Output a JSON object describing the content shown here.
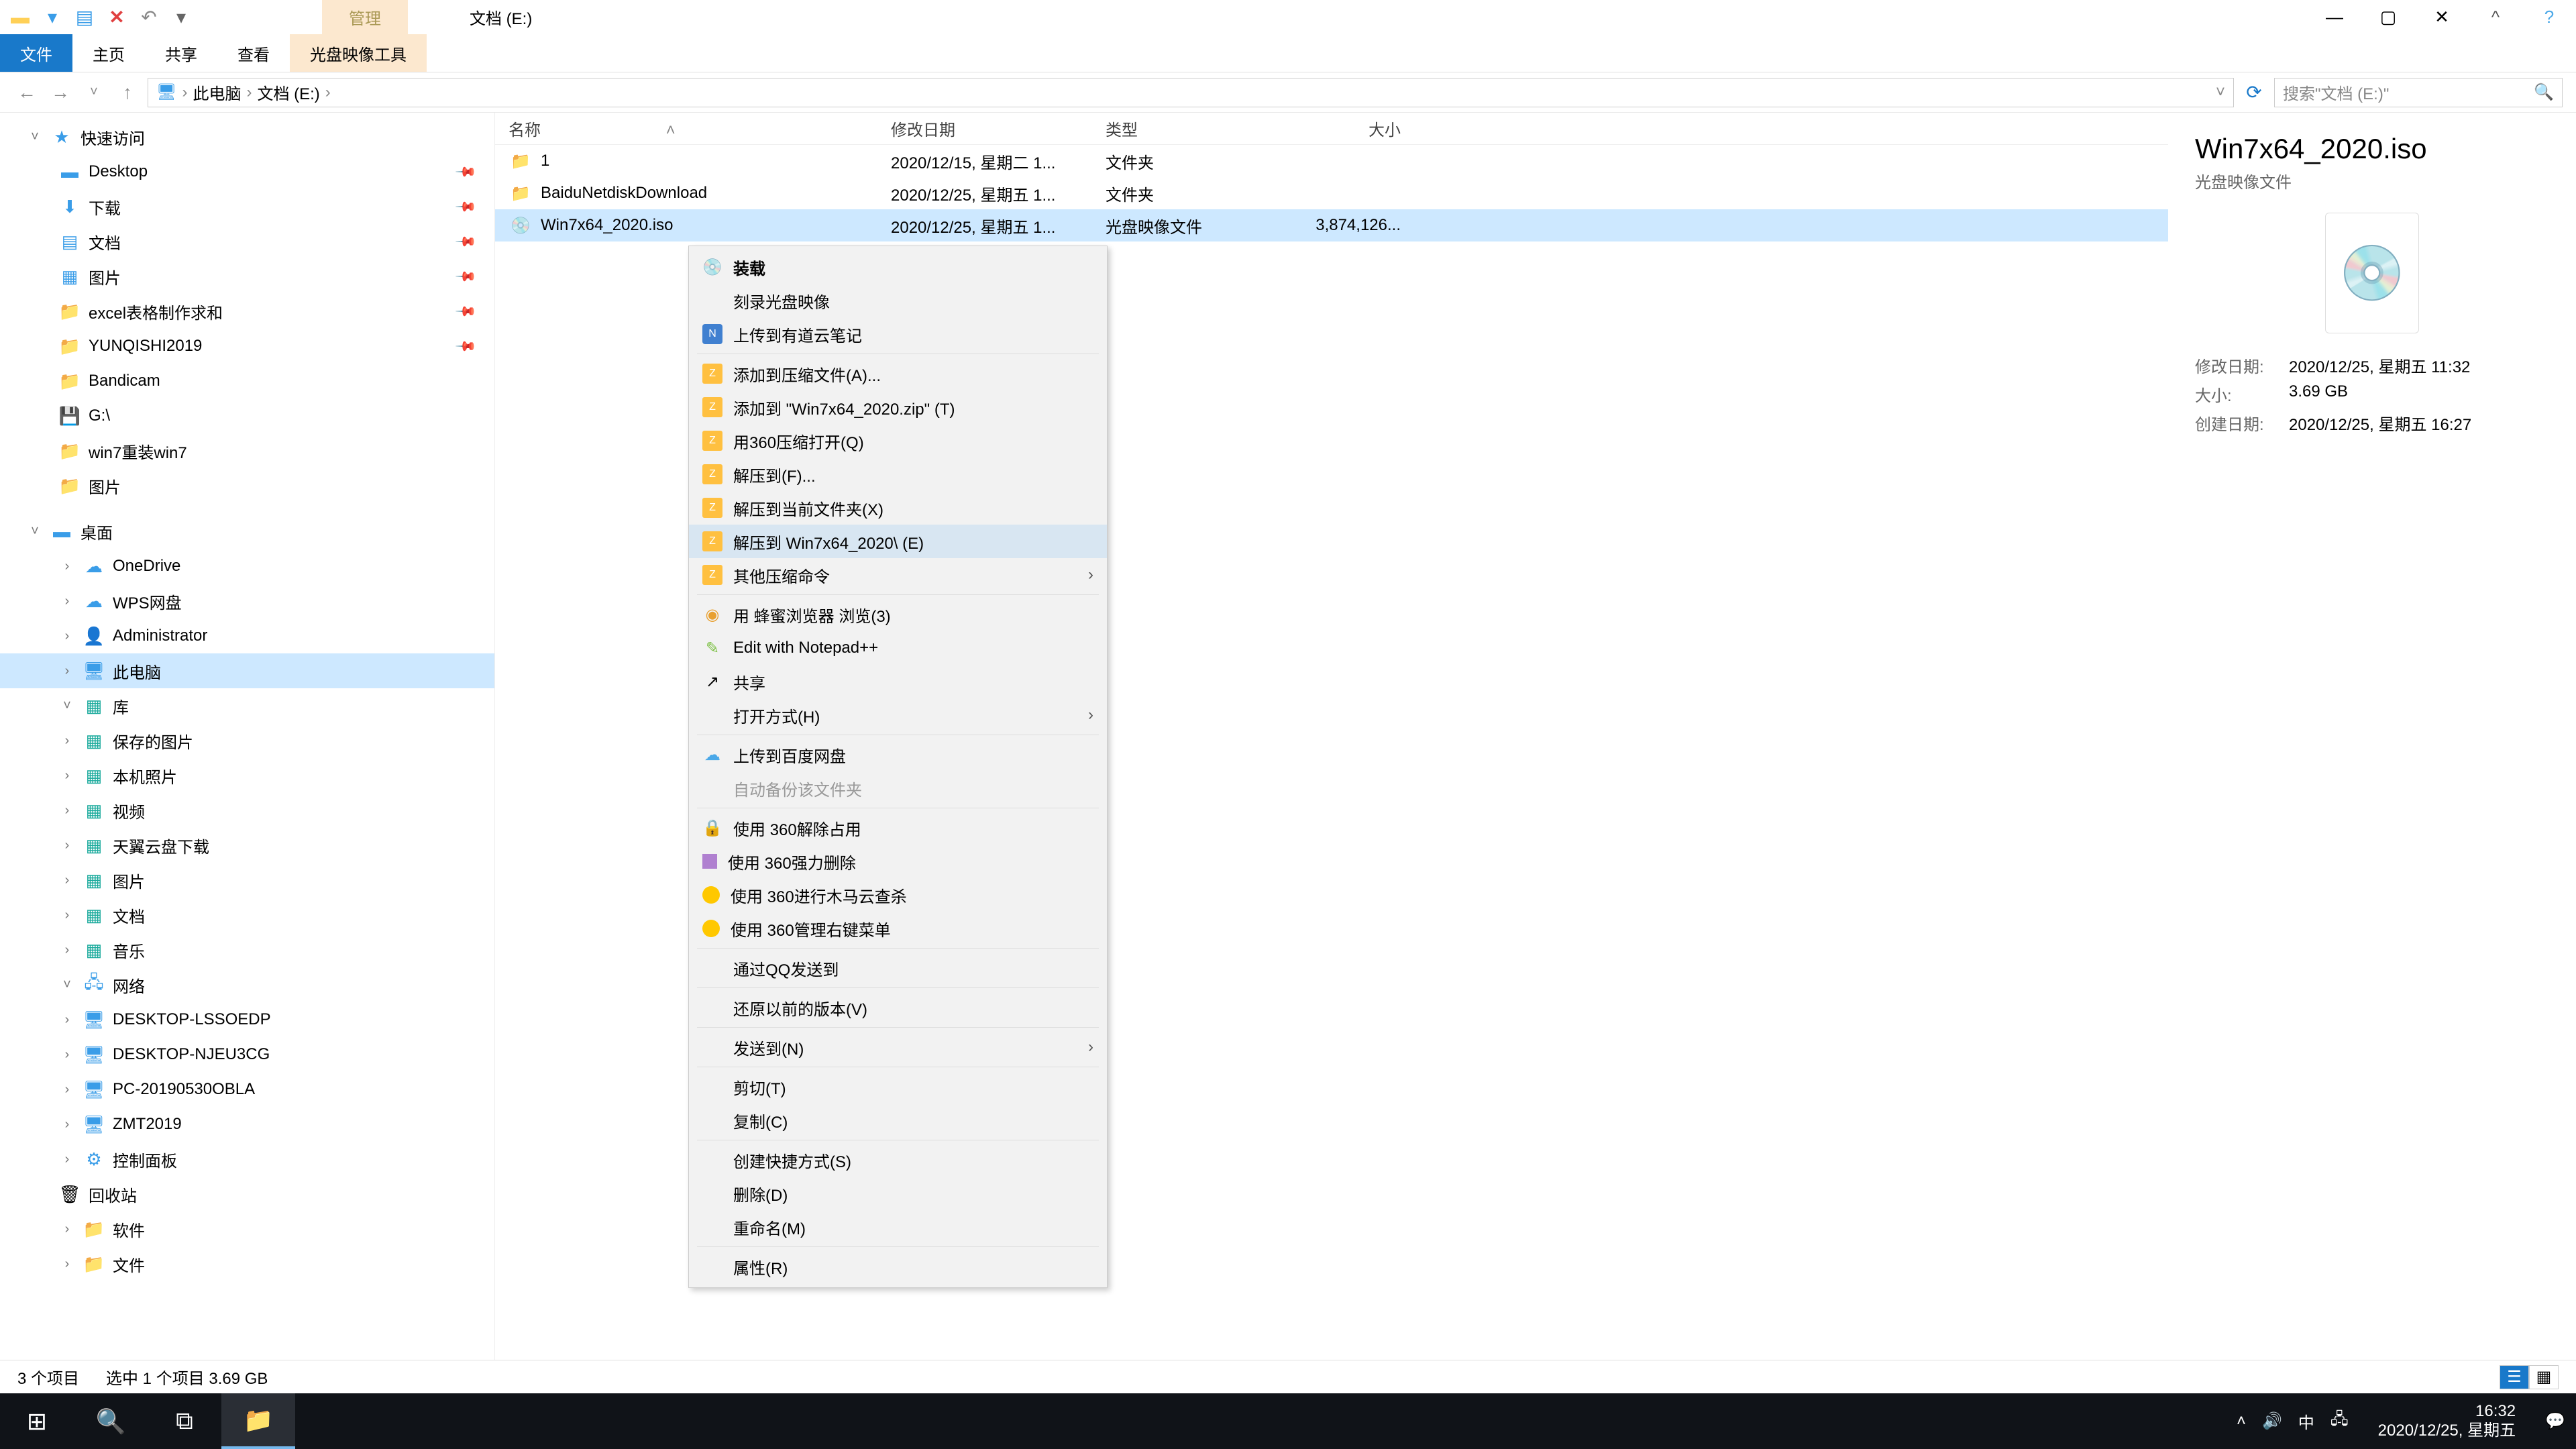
{
  "window": {
    "manage_tab": "管理",
    "title": "文档 (E:)"
  },
  "ribbon": {
    "file": "文件",
    "home": "主页",
    "share": "共享",
    "view": "查看",
    "disc_tools": "光盘映像工具"
  },
  "address": {
    "computer": "此电脑",
    "drive": "文档 (E:)",
    "search_placeholder": "搜索\"文档 (E:)\""
  },
  "tree": {
    "quick_access": "快速访问",
    "desktop": "Desktop",
    "downloads": "下载",
    "documents": "文档",
    "pictures": "图片",
    "excel": "excel表格制作求和",
    "yunqishi": "YUNQISHI2019",
    "bandicam": "Bandicam",
    "gdrive": "G:\\",
    "win7reinstall": "win7重装win7",
    "pictures2": "图片",
    "desktop2": "桌面",
    "onedrive": "OneDrive",
    "wps": "WPS网盘",
    "admin": "Administrator",
    "this_pc": "此电脑",
    "libraries": "库",
    "saved_pics": "保存的图片",
    "camera_roll": "本机照片",
    "videos": "视频",
    "tianyi": "天翼云盘下载",
    "lib_pics": "图片",
    "lib_docs": "文档",
    "lib_music": "音乐",
    "network": "网络",
    "pc1": "DESKTOP-LSSOEDP",
    "pc2": "DESKTOP-NJEU3CG",
    "pc3": "PC-20190530OBLA",
    "pc4": "ZMT2019",
    "control_panel": "控制面板",
    "recycle": "回收站",
    "software": "软件",
    "files": "文件"
  },
  "columns": {
    "name": "名称",
    "date": "修改日期",
    "type": "类型",
    "size": "大小"
  },
  "files": [
    {
      "name": "1",
      "date": "2020/12/15, 星期二 1...",
      "type": "文件夹",
      "size": "",
      "icon": "folder"
    },
    {
      "name": "BaiduNetdiskDownload",
      "date": "2020/12/25, 星期五 1...",
      "type": "文件夹",
      "size": "",
      "icon": "folder"
    },
    {
      "name": "Win7x64_2020.iso",
      "date": "2020/12/25, 星期五 1...",
      "type": "光盘映像文件",
      "size": "3,874,126...",
      "icon": "disc",
      "selected": true
    }
  ],
  "context_menu": {
    "mount": "装载",
    "burn": "刻录光盘映像",
    "youdao": "上传到有道云笔记",
    "add_archive": "添加到压缩文件(A)...",
    "add_zip": "添加到 \"Win7x64_2020.zip\" (T)",
    "open_360zip": "用360压缩打开(Q)",
    "extract_to": "解压到(F)...",
    "extract_here": "解压到当前文件夹(X)",
    "extract_named": "解压到 Win7x64_2020\\ (E)",
    "other_zip": "其他压缩命令",
    "browser": "用 蜂蜜浏览器 浏览(3)",
    "notepad": "Edit with Notepad++",
    "share": "共享",
    "open_with": "打开方式(H)",
    "baidu": "上传到百度网盘",
    "auto_backup": "自动备份该文件夹",
    "unlock360": "使用 360解除占用",
    "force_delete": "使用 360强力删除",
    "trojan": "使用 360进行木马云查杀",
    "manage_menu": "使用 360管理右键菜单",
    "qq_send": "通过QQ发送到",
    "restore": "还原以前的版本(V)",
    "send_to": "发送到(N)",
    "cut": "剪切(T)",
    "copy": "复制(C)",
    "shortcut": "创建快捷方式(S)",
    "delete": "删除(D)",
    "rename": "重命名(M)",
    "properties": "属性(R)"
  },
  "details": {
    "title": "Win7x64_2020.iso",
    "subtitle": "光盘映像文件",
    "mod_label": "修改日期:",
    "mod_value": "2020/12/25, 星期五 11:32",
    "size_label": "大小:",
    "size_value": "3.69 GB",
    "created_label": "创建日期:",
    "created_value": "2020/12/25, 星期五 16:27"
  },
  "status": {
    "count": "3 个项目",
    "selected": "选中 1 个项目  3.69 GB"
  },
  "taskbar": {
    "time": "16:32",
    "date": "2020/12/25, 星期五",
    "ime": "中"
  }
}
